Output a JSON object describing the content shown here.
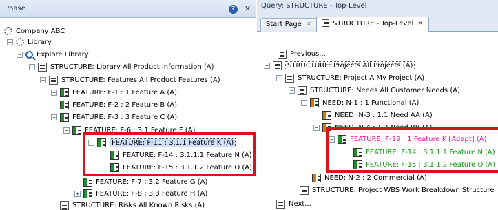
{
  "left_panel": {
    "title": "Phase",
    "help_symbol": "?",
    "close_symbol": "✕",
    "tree": [
      {
        "label": "Company ABC",
        "icon": "gear-icon",
        "exp": ""
      },
      {
        "label": "Library",
        "icon": "gear-icon",
        "exp": "−"
      },
      {
        "label": "Explore Library",
        "icon": "search-icon",
        "exp": "−"
      },
      {
        "label": "STRUCTURE: Library  All Product Information (A)",
        "icon": "document-icon",
        "exp": "−"
      },
      {
        "label": "STRUCTURE: Features  All Product Features (A)",
        "icon": "document-icon",
        "exp": "−"
      },
      {
        "label": "FEATURE: F-1 : 1 Feature A (A)",
        "icon": "feature-icon",
        "exp": "+"
      },
      {
        "label": "FEATURE: F-2 : 2 Feature B (A)",
        "icon": "feature-icon",
        "exp": ""
      },
      {
        "label": "FEATURE: F-3 : 3 Feature C (A)",
        "icon": "feature-icon",
        "exp": "−"
      },
      {
        "label": "FEATURE: F-6 : 3.1 Feature F (A)",
        "icon": "feature-icon",
        "exp": "−"
      },
      {
        "label": "FEATURE: F-11 : 3.1.1 Feature K (A)",
        "icon": "feature-icon",
        "exp": "−"
      },
      {
        "label": "FEATURE: F-14 : 3.1.1.1 Feature N (A)",
        "icon": "feature-icon",
        "exp": ""
      },
      {
        "label": "FEATURE: F-15 : 3.1.1.2 Feature O (A)",
        "icon": "feature-icon",
        "exp": ""
      },
      {
        "label": "FEATURE: F-7 : 3.2 Feature G (A)",
        "icon": "feature-icon",
        "exp": ""
      },
      {
        "label": "FEATURE: F-8 : 3.3 Feature H (A)",
        "icon": "feature-icon",
        "exp": "+"
      },
      {
        "label": "STRUCTURE: Risks  All Known Risks (A)",
        "icon": "document-icon",
        "exp": ""
      }
    ]
  },
  "right_panel": {
    "query_title": "Query: STRUCTURE - Top-Level",
    "tabs": [
      {
        "label": "Start Page",
        "close": "✕"
      },
      {
        "label": "STRUCTURE - Top-Level",
        "close": "✕"
      }
    ],
    "tree": [
      {
        "label": "Previous...",
        "icon": "document-icon",
        "exp": ""
      },
      {
        "label": "STRUCTURE: Projects  All Projects (A)",
        "icon": "document-icon",
        "exp": "−"
      },
      {
        "label": "STRUCTURE: Project A  My Project (A)",
        "icon": "document-icon",
        "exp": "−"
      },
      {
        "label": "STRUCTURE: Needs  All Customer Needs (A)",
        "icon": "document-icon",
        "exp": "−"
      },
      {
        "label": "NEED: N-1 : 1 Functional (A)",
        "icon": "need-icon",
        "exp": "−"
      },
      {
        "label": "NEED: N-3 : 1.1 Need AA (A)",
        "icon": "need-icon",
        "exp": ""
      },
      {
        "label": "NEED: N-4 : 1.2 Need BB (A)",
        "icon": "need-icon",
        "exp": "−"
      },
      {
        "label": "FEATURE: F-19 : 1 Feature K [Adapt] (A)",
        "icon": "feature-icon",
        "exp": "−"
      },
      {
        "label": "FEATURE: F-14 : 3.1.1.1 Feature N (A)",
        "icon": "feature-icon",
        "exp": ""
      },
      {
        "label": "FEATURE: F-15 : 3.1.1.2 Feature O (A)",
        "icon": "feature-icon",
        "exp": ""
      },
      {
        "label": "NEED: N-2 : 2 Commercial (A)",
        "icon": "need-icon",
        "exp": ""
      },
      {
        "label": "STRUCTURE: Project WBS  Work Breakdown Structure",
        "icon": "document-icon",
        "exp": ""
      },
      {
        "label": "Next...",
        "icon": "document-icon",
        "exp": ""
      }
    ]
  }
}
